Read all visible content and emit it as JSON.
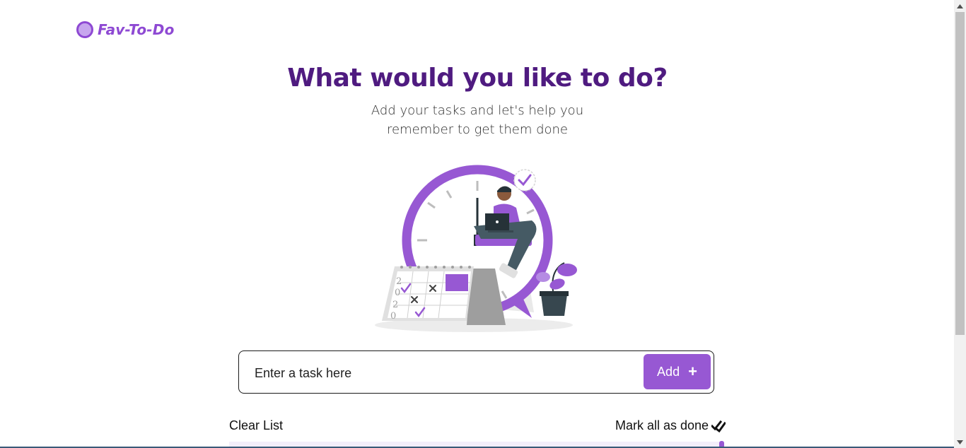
{
  "app": {
    "logo_text": "Fav-To-Do"
  },
  "hero": {
    "title": "What would you like to do?",
    "subtitle_line1": "Add your tasks and let's help you",
    "subtitle_line2": "remember to get them done"
  },
  "task_form": {
    "placeholder": "Enter a task here",
    "value": "",
    "add_label": "Add"
  },
  "list_actions": {
    "clear_label": "Clear List",
    "mark_all_label": "Mark all as done"
  },
  "calendar_year_digits": [
    "2",
    "0",
    "2",
    "0"
  ],
  "colors": {
    "brand": "#8e49d3",
    "title": "#4f1b80",
    "button": "#9758d3"
  },
  "icons": {
    "logo": "circle-logo-icon",
    "add": "plus-icon",
    "mark_all": "double-check-icon"
  }
}
